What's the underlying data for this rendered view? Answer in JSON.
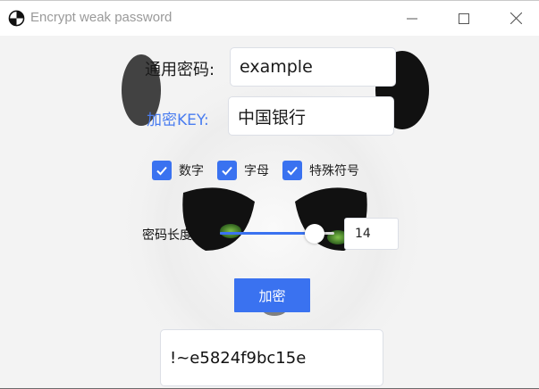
{
  "window": {
    "title": "Encrypt weak password",
    "controls": [
      "minimize-icon",
      "maximize-icon",
      "close-icon"
    ]
  },
  "form": {
    "password_label": "通用密码:",
    "password_value": "example",
    "key_label": "加密KEY:",
    "key_value": "中国银行",
    "options": [
      {
        "label": "数字",
        "checked": true
      },
      {
        "label": "字母",
        "checked": true
      },
      {
        "label": "特殊符号",
        "checked": true
      }
    ],
    "length_label": "密码长度",
    "length_value": "14",
    "length_slider_fraction": 0.83,
    "encrypt_button": "加密",
    "result": "!~e5824f9bc15e"
  },
  "colors": {
    "accent": "#3a72f0",
    "key_label": "#4a7df0",
    "title_text": "#9a9a9a"
  }
}
